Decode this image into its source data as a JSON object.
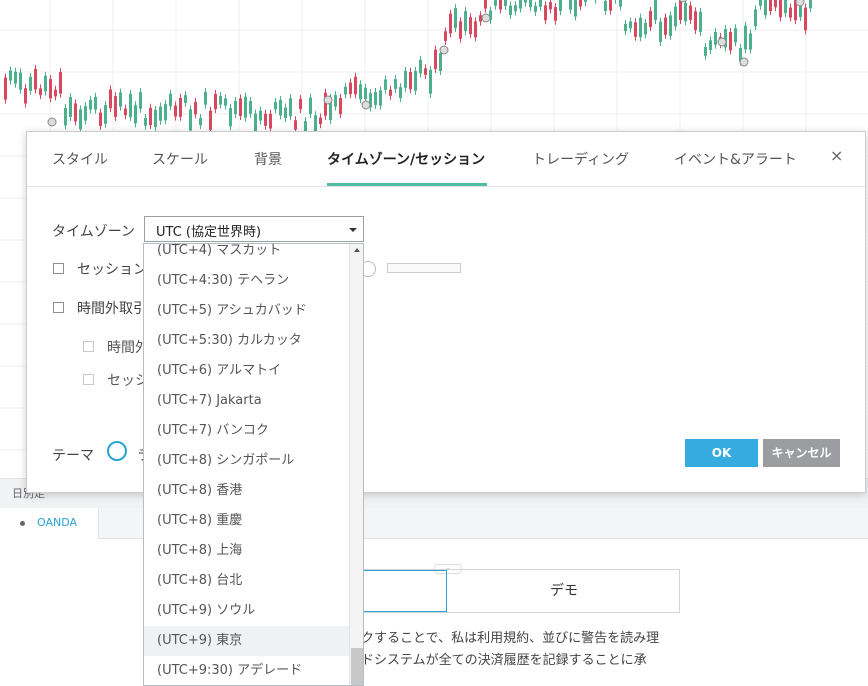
{
  "chart": {
    "bull_color": "#4cb08e",
    "bear_color": "#d8495f"
  },
  "bottom": {
    "strip_label": "日別足",
    "tab_label": "OANDA",
    "demo_label": "デモ",
    "terms_line1": "ックすることで、私は利用規約、並びに警告を読み理",
    "terms_line2": "ードシステムが全ての決済履歴を記録することに承"
  },
  "dialog": {
    "tabs": [
      {
        "label": "スタイル"
      },
      {
        "label": "スケール"
      },
      {
        "label": "背景"
      },
      {
        "label": "タイムゾーン/セッション"
      },
      {
        "label": "トレーディング"
      },
      {
        "label": "イベント&アラート"
      }
    ],
    "close_label": "×",
    "timezone": {
      "label": "タイムゾーン",
      "value": "UTC (協定世界時)"
    },
    "options": [
      {
        "label": "セッション"
      },
      {
        "label": "時間外取引"
      },
      {
        "label": "時間外"
      },
      {
        "label": "セッシ"
      }
    ],
    "theme_label": "テーマ",
    "theme_peek": "ラ",
    "ok_label": "OK",
    "cancel_label": "キャンセル",
    "accent": "#36abe0"
  },
  "dropdown": {
    "items": [
      {
        "label": "(UTC+4) マスカット"
      },
      {
        "label": "(UTC+4:30) テヘラン"
      },
      {
        "label": "(UTC+5) アシュカバッド"
      },
      {
        "label": "(UTC+5:30) カルカッタ"
      },
      {
        "label": "(UTC+6) アルマトイ"
      },
      {
        "label": "(UTC+7) Jakarta"
      },
      {
        "label": "(UTC+7) バンコク"
      },
      {
        "label": "(UTC+8) シンガポール"
      },
      {
        "label": "(UTC+8) 香港"
      },
      {
        "label": "(UTC+8) 重慶"
      },
      {
        "label": "(UTC+8) 上海"
      },
      {
        "label": "(UTC+8) 台北"
      },
      {
        "label": "(UTC+9) ソウル"
      },
      {
        "label": "(UTC+9) 東京"
      },
      {
        "label": "(UTC+9:30) アデレード"
      }
    ],
    "highlighted": "(UTC+9) 東京"
  }
}
